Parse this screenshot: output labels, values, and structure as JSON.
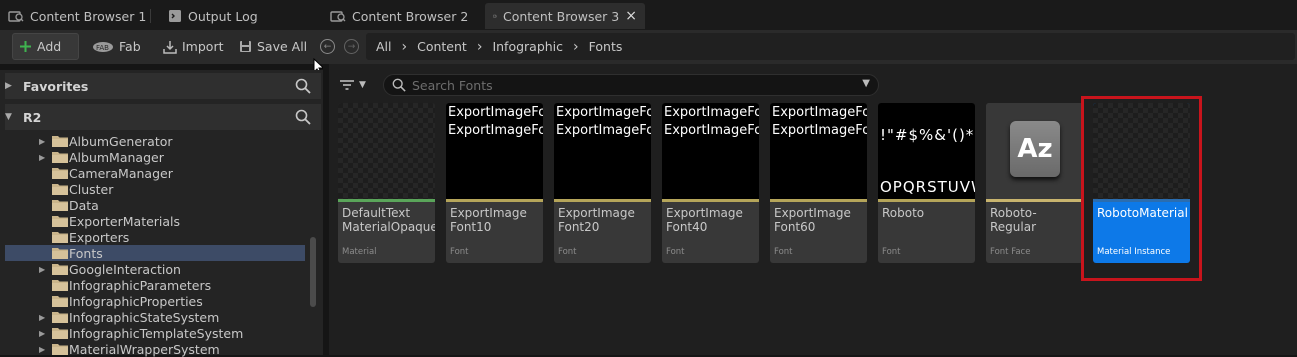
{
  "tabs": [
    {
      "label": "Content Browser 1",
      "icon": "content-browser-icon",
      "active": false
    },
    {
      "label": "Output Log",
      "icon": "output-log-icon",
      "active": false
    },
    {
      "label": "Content Browser 2",
      "icon": "content-browser-icon",
      "active": false
    },
    {
      "label": "Content Browser 3",
      "icon": "content-browser-icon",
      "active": true,
      "close": "×"
    }
  ],
  "toolbar": {
    "add": "Add",
    "fab": "Fab",
    "import": "Import",
    "save_all": "Save All"
  },
  "breadcrumb": [
    "All",
    "Content",
    "Infographic",
    "Fonts"
  ],
  "left_panel": {
    "favorites": "Favorites",
    "root": "R2",
    "tree": [
      {
        "label": "AlbumGenerator",
        "expandable": true
      },
      {
        "label": "AlbumManager",
        "expandable": true
      },
      {
        "label": "CameraManager",
        "expandable": false
      },
      {
        "label": "Cluster",
        "expandable": false
      },
      {
        "label": "Data",
        "expandable": false
      },
      {
        "label": "ExporterMaterials",
        "expandable": false
      },
      {
        "label": "Exporters",
        "expandable": false
      },
      {
        "label": "Fonts",
        "expandable": false,
        "selected": true
      },
      {
        "label": "GoogleInteraction",
        "expandable": true
      },
      {
        "label": "InfographicParameters",
        "expandable": false
      },
      {
        "label": "InfographicProperties",
        "expandable": false
      },
      {
        "label": "InfographicStateSystem",
        "expandable": true
      },
      {
        "label": "InfographicTemplateSystem",
        "expandable": true
      },
      {
        "label": "MaterialWrapperSystem",
        "expandable": true
      }
    ]
  },
  "search": {
    "placeholder": "Search Fonts"
  },
  "assets": [
    {
      "name": "DefaultText\nMaterialOpaque",
      "type": "Material",
      "thumb": "checker",
      "stripe": "#5aa55a"
    },
    {
      "name": "ExportImage\nFont10",
      "type": "Font",
      "thumb": "text",
      "preview": "ExportImageFont\nExportImageFont",
      "stripe": "#b5a55a"
    },
    {
      "name": "ExportImage\nFont20",
      "type": "Font",
      "thumb": "text",
      "preview": "ExportImageFont\nExportImageFont",
      "stripe": "#b5a55a"
    },
    {
      "name": "ExportImage\nFont40",
      "type": "Font",
      "thumb": "text",
      "preview": "ExportImageFont\nExportImageFont",
      "stripe": "#b5a55a"
    },
    {
      "name": "ExportImage\nFont60",
      "type": "Font",
      "thumb": "text",
      "preview": "ExportImageFont\nExportImageFont",
      "stripe": "#b5a55a"
    },
    {
      "name": "Roboto",
      "type": "Font",
      "thumb": "glyphs",
      "preview": "!\"#$%&'()*+,-.\nOPQRSTUVWXYZ",
      "stripe": "#b5a55a"
    },
    {
      "name": "Roboto-Regular",
      "type": "Font Face",
      "thumb": "az",
      "preview": "Az",
      "stripe": "#c8b46e"
    },
    {
      "name": "RobotoMaterial",
      "type": "Material Instance",
      "thumb": "checker",
      "stripe": "#2a6db0",
      "selected": true
    }
  ],
  "colors": {
    "accent": "#0d79e8",
    "highlight": "#c8141c",
    "add_green": "#3fb34f"
  }
}
